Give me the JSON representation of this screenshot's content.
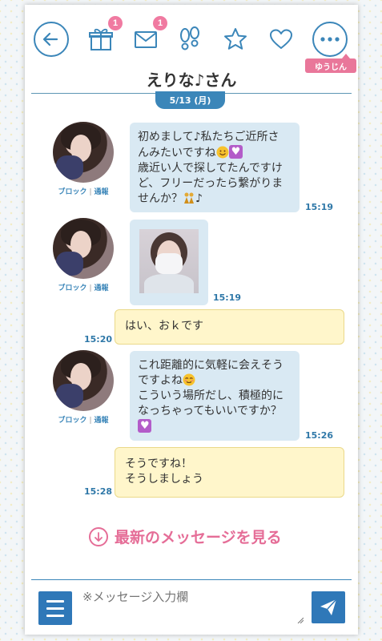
{
  "header": {
    "back_icon": "arrow-left-circle-icon",
    "gift_badge": "1",
    "mail_badge": "1",
    "footprints_icon": "footprints-icon",
    "star_icon": "star-icon",
    "heart_icon": "heart-icon",
    "more_badge": "ゆうじん",
    "title": "えりな♪さん",
    "accent_color": "#3b86b9"
  },
  "date_label": "5/13 (月)",
  "avatar_links": {
    "block": "ブロック",
    "sep": "|",
    "report": "通報"
  },
  "messages": [
    {
      "side": "in",
      "lines": [
        "初めまして♪私たちご近所さ",
        "んみたいですね",
        "歳近い人で探してたんですけ",
        "ど、フリーだったら繋がりま",
        "せんか？"
      ],
      "time": "15:19"
    },
    {
      "side": "in",
      "type": "image",
      "time": "15:19"
    },
    {
      "side": "out",
      "text": "はい、おｋです",
      "time": "15:20"
    },
    {
      "side": "in",
      "lines": [
        "これ距離的に気軽に会えそう",
        "ですよね",
        "こういう場所だし、積極的に",
        "なっちゃってもいいですか？"
      ],
      "time": "15:26"
    },
    {
      "side": "out",
      "lines": [
        "そうですね！",
        "そうしましょう"
      ],
      "time": "15:28"
    }
  ],
  "latest_link": "最新のメッセージを見る",
  "composer": {
    "placeholder": "※メッセージ入力欄"
  }
}
